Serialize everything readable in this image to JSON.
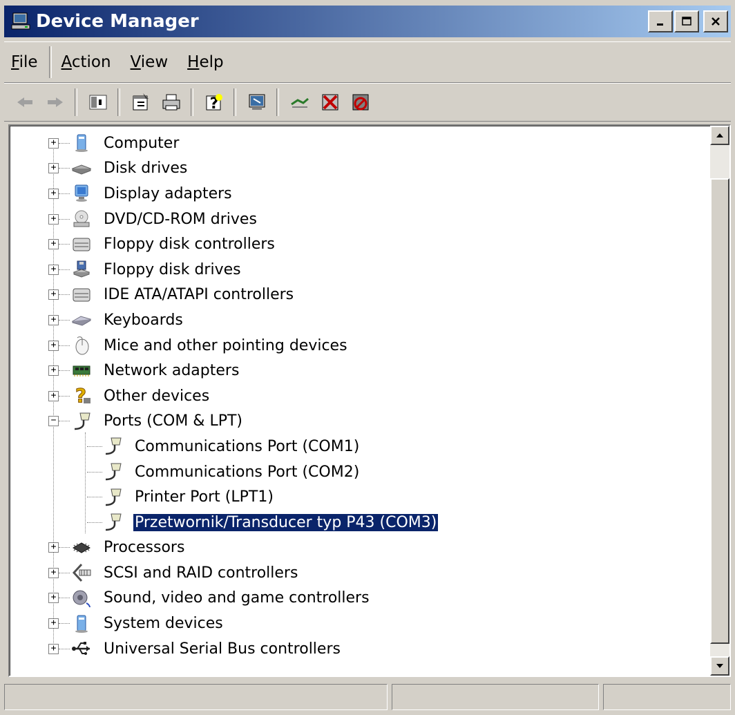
{
  "window": {
    "title": "Device Manager",
    "controls": {
      "minimize": "_",
      "maximize": "□",
      "close": "×"
    }
  },
  "menubar": {
    "items": [
      {
        "label": "File",
        "accel": "F",
        "rest": "ile"
      },
      {
        "label": "Action",
        "accel": "A",
        "rest": "ction"
      },
      {
        "label": "View",
        "accel": "V",
        "rest": "iew"
      },
      {
        "label": "Help",
        "accel": "H",
        "rest": "elp"
      }
    ]
  },
  "toolbar": {
    "buttons": [
      "back-icon",
      "forward-icon",
      "show-hide-tree-icon",
      "properties-icon",
      "print-icon",
      "help-icon",
      "scan-hardware-icon",
      "update-driver-icon",
      "uninstall-icon",
      "disable-icon"
    ]
  },
  "tree": {
    "items": [
      {
        "label": "Computer",
        "icon": "computer-icon",
        "expanded": false
      },
      {
        "label": "Disk drives",
        "icon": "disk-drive-icon",
        "expanded": false
      },
      {
        "label": "Display adapters",
        "icon": "display-adapter-icon",
        "expanded": false
      },
      {
        "label": "DVD/CD-ROM drives",
        "icon": "dvd-drive-icon",
        "expanded": false
      },
      {
        "label": "Floppy disk controllers",
        "icon": "controller-icon",
        "expanded": false
      },
      {
        "label": "Floppy disk drives",
        "icon": "floppy-drive-icon",
        "expanded": false
      },
      {
        "label": "IDE ATA/ATAPI controllers",
        "icon": "controller-icon",
        "expanded": false
      },
      {
        "label": "Keyboards",
        "icon": "keyboard-icon",
        "expanded": false
      },
      {
        "label": "Mice and other pointing devices",
        "icon": "mouse-icon",
        "expanded": false
      },
      {
        "label": "Network adapters",
        "icon": "network-adapter-icon",
        "expanded": false
      },
      {
        "label": "Other devices",
        "icon": "unknown-device-icon",
        "expanded": false
      },
      {
        "label": "Ports (COM & LPT)",
        "icon": "port-icon",
        "expanded": true,
        "children": [
          {
            "label": "Communications Port (COM1)",
            "icon": "port-icon"
          },
          {
            "label": "Communications Port (COM2)",
            "icon": "port-icon"
          },
          {
            "label": "Printer Port (LPT1)",
            "icon": "port-icon"
          },
          {
            "label": "Przetwornik/Transducer typ P43 (COM3)",
            "icon": "port-icon",
            "selected": true
          }
        ]
      },
      {
        "label": "Processors",
        "icon": "processor-icon",
        "expanded": false
      },
      {
        "label": "SCSI and RAID controllers",
        "icon": "scsi-icon",
        "expanded": false
      },
      {
        "label": "Sound, video and game controllers",
        "icon": "sound-icon",
        "expanded": false
      },
      {
        "label": "System devices",
        "icon": "system-device-icon",
        "expanded": false
      },
      {
        "label": "Universal Serial Bus controllers",
        "icon": "usb-icon",
        "expanded": false
      }
    ]
  },
  "colors": {
    "title_gradient_start": "#0a246a",
    "title_gradient_end": "#a6caf0",
    "selection": "#0a246a",
    "face": "#d4d0c8"
  },
  "statusbar": {
    "cells": [
      "",
      "",
      ""
    ]
  }
}
